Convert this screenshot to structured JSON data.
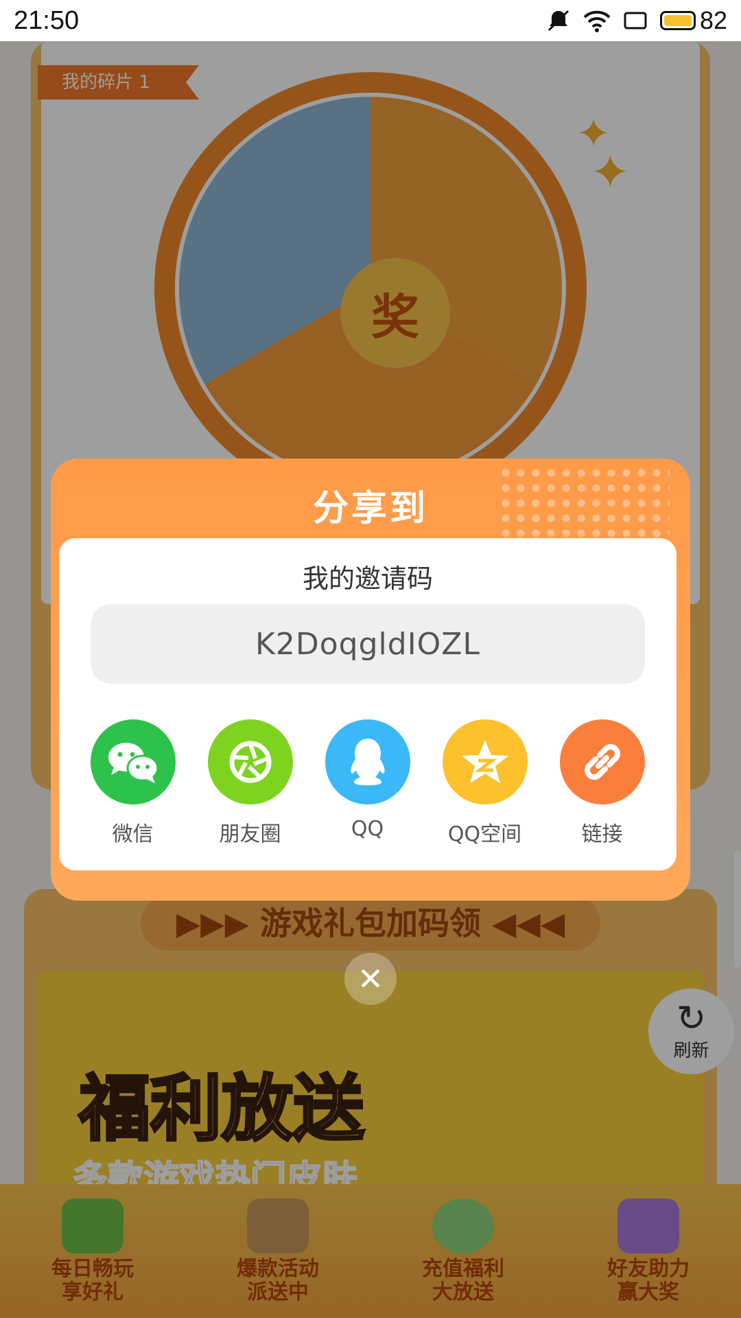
{
  "status_bar": {
    "time": "21:50",
    "battery": "82"
  },
  "background": {
    "fragment_tag": "我的碎片 1",
    "wheel_center": "奖",
    "gift_title": "▶▶▶ 游戏礼包加码领 ◀◀◀",
    "welfare_title": "福利放送",
    "welfare_subtitle": "多款游戏热门皮肤",
    "refresh_label": "刷新",
    "nav": [
      {
        "line1": "每日畅玩",
        "line2": "享好礼"
      },
      {
        "line1": "爆款活动",
        "line2": "派送中"
      },
      {
        "line1": "充值福利",
        "line2": "大放送"
      },
      {
        "line1": "好友助力",
        "line2": "赢大奖"
      }
    ]
  },
  "dialog": {
    "title": "分享到",
    "invite_label": "我的邀请码",
    "invite_code": "K2DoqgldIOZL",
    "share_targets": [
      {
        "label": "微信",
        "icon": "wechat-icon",
        "color": "#2dc24b"
      },
      {
        "label": "朋友圈",
        "icon": "moments-icon",
        "color": "#7ed321"
      },
      {
        "label": "QQ",
        "icon": "qq-icon",
        "color": "#3ab8f8"
      },
      {
        "label": "QQ空间",
        "icon": "qzone-icon",
        "color": "#fcc12d"
      },
      {
        "label": "链接",
        "icon": "link-icon",
        "color": "#fb7f3c"
      }
    ]
  },
  "colors": {
    "dialog_orange": "#ff9a48",
    "overlay": "rgba(0,0,0,0.38)"
  }
}
